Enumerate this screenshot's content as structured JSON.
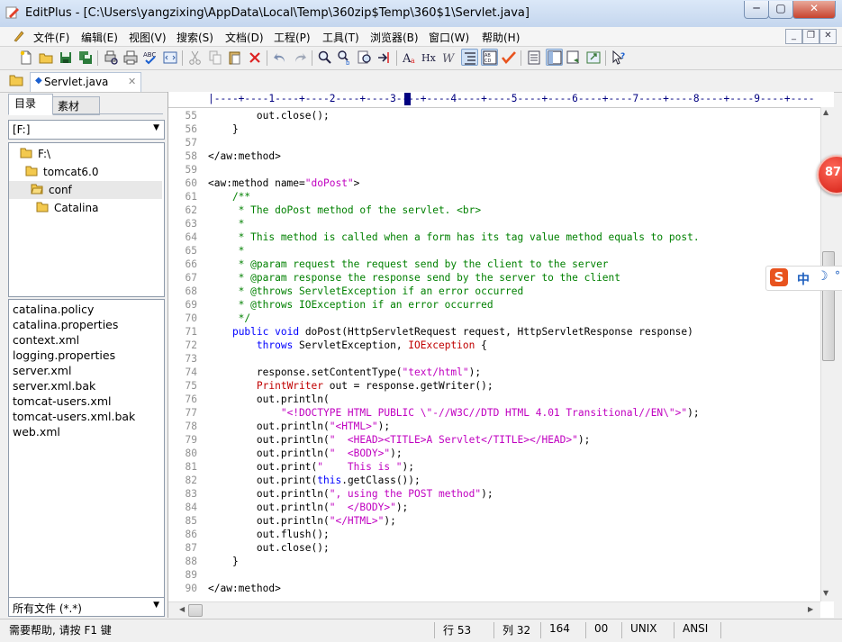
{
  "window": {
    "title": "EditPlus - [C:\\Users\\yangzixing\\AppData\\Local\\Temp\\360zip$Temp\\360$1\\Servlet.java]"
  },
  "window_buttons": {
    "minimize": "─",
    "maximize": "▢",
    "close": "✕"
  },
  "menu": [
    "文件(F)",
    "编辑(E)",
    "视图(V)",
    "搜索(S)",
    "文档(D)",
    "工程(P)",
    "工具(T)",
    "浏览器(B)",
    "窗口(W)",
    "帮助(H)"
  ],
  "mdi_buttons": {
    "minimize": "_",
    "restore": "❐",
    "close": "✕"
  },
  "tabs": {
    "file": "Servlet.java",
    "close": "✕"
  },
  "left_panel": {
    "tab_directory": "目录",
    "tab_material": "素材",
    "drive": "[F:]",
    "tree": [
      "F:\\",
      "tomcat6.0",
      "conf",
      "Catalina"
    ],
    "files": [
      "catalina.policy",
      "catalina.properties",
      "context.xml",
      "logging.properties",
      "server.xml",
      "server.xml.bak",
      "tomcat-users.xml",
      "tomcat-users.xml.bak",
      "web.xml"
    ],
    "filter": "所有文件 (*.*)"
  },
  "editor": {
    "ruler": "|----+----1----+----2----+----3----+----4----+----5----+----6----+----7----+----8----+----9----+----",
    "lines": [
      {
        "n": "55",
        "t": "        out.close();"
      },
      {
        "n": "56",
        "t": "    }"
      },
      {
        "n": "57",
        "t": ""
      },
      {
        "n": "58",
        "t": "</aw:method>"
      },
      {
        "n": "59",
        "t": ""
      },
      {
        "n": "60",
        "t": "<aw:method name=\"doPost\">"
      },
      {
        "n": "61",
        "t": "    /**"
      },
      {
        "n": "62",
        "t": "     * The doPost method of the servlet. <br>"
      },
      {
        "n": "63",
        "t": "     *"
      },
      {
        "n": "64",
        "t": "     * This method is called when a form has its tag value method equals to post."
      },
      {
        "n": "65",
        "t": "     *"
      },
      {
        "n": "66",
        "t": "     * @param request the request send by the client to the server"
      },
      {
        "n": "67",
        "t": "     * @param response the response send by the server to the client"
      },
      {
        "n": "68",
        "t": "     * @throws ServletException if an error occurred"
      },
      {
        "n": "69",
        "t": "     * @throws IOException if an error occurred"
      },
      {
        "n": "70",
        "t": "     */"
      },
      {
        "n": "71",
        "t": "    public void doPost(HttpServletRequest request, HttpServletResponse response)"
      },
      {
        "n": "72",
        "t": "        throws ServletException, IOException {"
      },
      {
        "n": "73",
        "t": ""
      },
      {
        "n": "74",
        "t": "        response.setContentType(\"text/html\");"
      },
      {
        "n": "75",
        "t": "        PrintWriter out = response.getWriter();"
      },
      {
        "n": "76",
        "t": "        out.println("
      },
      {
        "n": "77",
        "t": "            \"<!DOCTYPE HTML PUBLIC \\\"-//W3C//DTD HTML 4.01 Transitional//EN\\\">\");"
      },
      {
        "n": "78",
        "t": "        out.println(\"<HTML>\");"
      },
      {
        "n": "79",
        "t": "        out.println(\"  <HEAD><TITLE>A Servlet</TITLE></HEAD>\");"
      },
      {
        "n": "80",
        "t": "        out.println(\"  <BODY>\");"
      },
      {
        "n": "81",
        "t": "        out.print(\"    This is \");"
      },
      {
        "n": "82",
        "t": "        out.print(this.getClass());"
      },
      {
        "n": "83",
        "t": "        out.println(\", using the POST method\");"
      },
      {
        "n": "84",
        "t": "        out.println(\"  </BODY>\");"
      },
      {
        "n": "85",
        "t": "        out.println(\"</HTML>\");"
      },
      {
        "n": "86",
        "t": "        out.flush();"
      },
      {
        "n": "87",
        "t": "        out.close();"
      },
      {
        "n": "88",
        "t": "    }"
      },
      {
        "n": "89",
        "t": ""
      },
      {
        "n": "90",
        "t": "</aw:method>"
      }
    ]
  },
  "status": {
    "help": "需要帮助, 请按 F1 键",
    "row": "行 53",
    "col": "列 32",
    "chars": "164",
    "code": "00",
    "eol": "UNIX",
    "encoding": "ANSI"
  },
  "overlay": {
    "badge": "87",
    "ime_logo": "S",
    "ime_mode": "中",
    "ime_moon": "☽",
    "ime_dot": "°"
  },
  "colors": {
    "comment": "#008000",
    "string": "#c000c0",
    "keyword": "#0000ff",
    "type": "#c00000",
    "line_number": "#909090",
    "ruler": "#000080"
  }
}
